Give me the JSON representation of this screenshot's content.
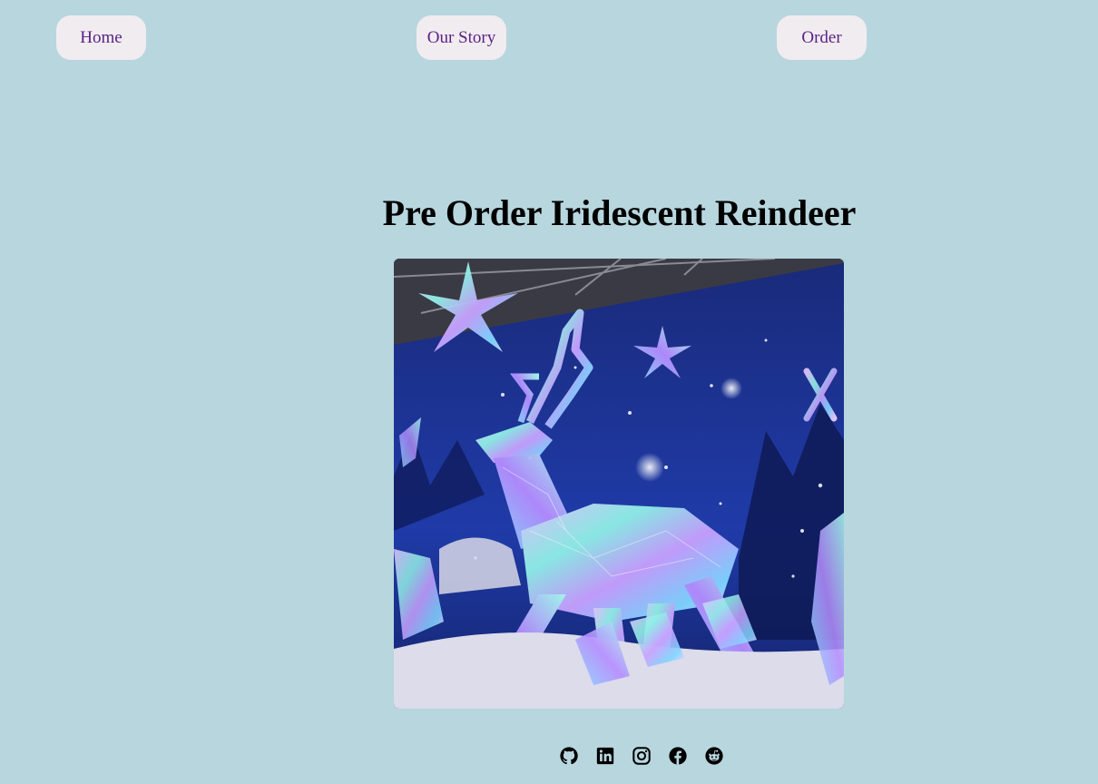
{
  "nav": {
    "home_label": "Home",
    "story_label": "Our Story",
    "order_label": "Order"
  },
  "main": {
    "title": "Pre Order Iridescent Reindeer",
    "image_alt": "Iridescent crystal reindeer sculpture with stars and snowflakes on a blue night backdrop"
  },
  "footer": {
    "social_icons": [
      "github-icon",
      "linkedin-icon",
      "instagram-icon",
      "facebook-icon",
      "reddit-icon"
    ]
  },
  "colors": {
    "background": "#b8d6de",
    "nav_button_bg": "#f1ecf0",
    "nav_text": "#5b2286"
  }
}
